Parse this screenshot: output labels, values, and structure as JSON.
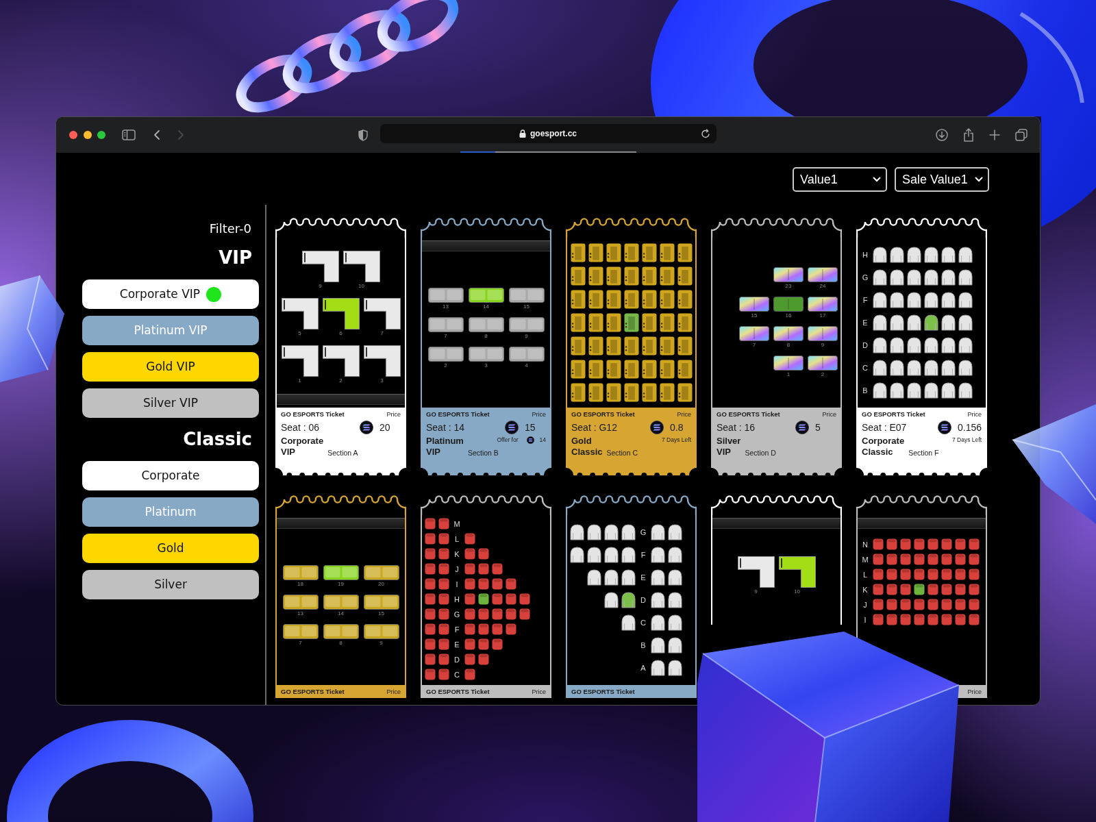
{
  "browser": {
    "url": "goesport.cc",
    "nav": [
      {
        "kind": "back",
        "disabled": false
      },
      {
        "kind": "forward",
        "disabled": true
      }
    ],
    "load_progress": {
      "level": 0.2
    }
  },
  "filters": {
    "selects": [
      {
        "value": "Value1"
      },
      {
        "value": "Sale Value1"
      }
    ]
  },
  "sidebar": {
    "title": "Filter-0",
    "groups": [
      {
        "heading": "VIP",
        "items": [
          {
            "label": "Corporate VIP",
            "color": "#ffffff",
            "selected": true
          },
          {
            "label": "Platinum VIP",
            "color": "#87a9c5",
            "selected": false
          },
          {
            "label": "Gold VIP",
            "color": "#ffd700",
            "selected": false
          },
          {
            "label": "Silver VIP",
            "color": "#c0c0c0",
            "selected": false
          }
        ]
      },
      {
        "heading": "Classic",
        "items": [
          {
            "label": "Corporate",
            "color": "#ffffff",
            "selected": false
          },
          {
            "label": "Platinum",
            "color": "#87a9c5",
            "selected": false
          },
          {
            "label": "Gold",
            "color": "#ffd700",
            "selected": false
          },
          {
            "label": "Silver",
            "color": "#c0c0c0",
            "selected": false
          }
        ]
      }
    ]
  },
  "tickets": [
    {
      "color": "#ffffff",
      "header": "GO ESPORTS Ticket",
      "price_label": "Price",
      "seat": "Seat : 06",
      "price": "20",
      "tier": "Corporate VIP",
      "section": "Section A",
      "map": {
        "kind": "desk",
        "stage_bottom": true,
        "rows": [
          {
            "seats": [
              {
                "number": "9",
                "selected": false
              },
              {
                "number": "10",
                "selected": false
              }
            ]
          },
          {
            "seats": [
              {
                "number": "5",
                "selected": false
              },
              {
                "number": "6",
                "selected": true
              },
              {
                "number": "7",
                "selected": false
              }
            ]
          },
          {
            "seats": [
              {
                "number": "1",
                "selected": false
              },
              {
                "number": "2",
                "selected": false
              },
              {
                "number": "3",
                "selected": false
              }
            ]
          }
        ]
      }
    },
    {
      "color": "#87a9c5",
      "header": "GO ESPORTS Ticket",
      "price_label": "Price",
      "seat": "Seat : 14",
      "price": "15",
      "tier": "Platinum VIP",
      "offer": {
        "label": "Offer for",
        "price": "14"
      },
      "section": "Section B",
      "map": {
        "kind": "sofa",
        "stage_top": true,
        "rows": [
          {
            "seats": [
              {
                "number": "13",
                "selected": false
              },
              {
                "number": "14",
                "selected": true
              },
              {
                "number": "15",
                "selected": false
              }
            ]
          },
          {
            "seats": [
              {
                "number": "7",
                "selected": false
              },
              {
                "number": "8",
                "selected": false
              },
              {
                "number": "9",
                "selected": false
              }
            ]
          },
          {
            "seats": [
              {
                "number": "2",
                "selected": false
              },
              {
                "number": "3",
                "selected": false
              },
              {
                "number": "4",
                "selected": false
              }
            ]
          }
        ]
      }
    },
    {
      "color": "#d6a532",
      "header": "GO ESPORTS Ticket",
      "price_label": "Price",
      "seat": "Seat : G12",
      "price": "0.8",
      "tier": "Gold Classic",
      "time_left": "7 Days Left",
      "section": "Section C",
      "map": {
        "kind": "chair",
        "rows": [
          {
            "seats": [
              {
                "selected": false
              },
              {
                "selected": false
              },
              {
                "selected": false
              },
              {
                "selected": false
              },
              {
                "selected": false
              },
              {
                "selected": false
              },
              {
                "selected": false
              }
            ]
          },
          {
            "seats": [
              {
                "selected": false
              },
              {
                "selected": false
              },
              {
                "selected": false
              },
              {
                "selected": false
              },
              {
                "selected": false
              },
              {
                "selected": false
              },
              {
                "selected": false
              }
            ]
          },
          {
            "seats": [
              {
                "selected": false
              },
              {
                "selected": false
              },
              {
                "selected": false
              },
              {
                "selected": false
              },
              {
                "selected": false
              },
              {
                "selected": false
              },
              {
                "selected": false
              }
            ]
          },
          {
            "seats": [
              {
                "selected": false
              },
              {
                "selected": false
              },
              {
                "selected": false
              },
              {
                "selected": true
              },
              {
                "selected": false
              },
              {
                "selected": false
              },
              {
                "selected": false
              }
            ]
          },
          {
            "seats": [
              {
                "selected": false
              },
              {
                "selected": false
              },
              {
                "selected": false
              },
              {
                "selected": false
              },
              {
                "selected": false
              },
              {
                "selected": false
              },
              {
                "selected": false
              }
            ]
          },
          {
            "seats": [
              {
                "selected": false
              },
              {
                "selected": false
              },
              {
                "selected": false
              },
              {
                "selected": false
              },
              {
                "selected": false
              },
              {
                "selected": false
              },
              {
                "selected": false
              }
            ]
          },
          {
            "seats": [
              {
                "selected": false
              },
              {
                "selected": false
              },
              {
                "selected": false
              },
              {
                "selected": false
              },
              {
                "selected": false
              },
              {
                "selected": false
              },
              {
                "selected": false
              }
            ]
          }
        ]
      }
    },
    {
      "color": "#bdbdbd",
      "header": "GO ESPORTS Ticket",
      "price_label": "Price",
      "seat": "Seat : 16",
      "price": "5",
      "tier": "Silver VIP",
      "section": "Section D",
      "map": {
        "kind": "pod",
        "rows": [
          {
            "seats": [
              {
                "number": "23",
                "selected": false
              },
              {
                "number": "24",
                "selected": false
              }
            ]
          },
          {
            "seats": [
              {
                "number": "15",
                "selected": false
              },
              {
                "number": "16",
                "selected": true
              },
              {
                "number": "17",
                "selected": false
              }
            ]
          },
          {
            "seats": [
              {
                "number": "7",
                "selected": false
              },
              {
                "number": "8",
                "selected": false
              },
              {
                "number": "9",
                "selected": false
              }
            ]
          },
          {
            "seats": [
              {
                "number": "1",
                "selected": false
              },
              {
                "number": "2",
                "selected": false
              }
            ]
          }
        ]
      }
    },
    {
      "color": "#ffffff",
      "header": "GO ESPORTS Ticket",
      "price_label": "Price",
      "seat": "Seat : E07",
      "price": "0.156",
      "tier": "Corporate Classic",
      "time_left": "7 Days Left",
      "section": "Section F",
      "map": {
        "kind": "armchair",
        "rows": [
          {
            "label": "H",
            "seats": [
              {
                "selected": false
              },
              {
                "selected": false
              },
              {
                "selected": false
              },
              {
                "selected": false
              },
              {
                "selected": false
              },
              {
                "selected": false
              }
            ]
          },
          {
            "label": "G",
            "seats": [
              {
                "selected": false
              },
              {
                "selected": false
              },
              {
                "selected": false
              },
              {
                "selected": false
              },
              {
                "selected": false
              },
              {
                "selected": false
              }
            ]
          },
          {
            "label": "F",
            "seats": [
              {
                "selected": false
              },
              {
                "selected": false
              },
              {
                "selected": false
              },
              {
                "selected": false
              },
              {
                "selected": false
              },
              {
                "selected": false
              }
            ]
          },
          {
            "label": "E",
            "seats": [
              {
                "selected": false
              },
              {
                "selected": false
              },
              {
                "selected": false
              },
              {
                "selected": true
              },
              {
                "selected": false
              },
              {
                "selected": false
              }
            ]
          },
          {
            "label": "D",
            "seats": [
              {
                "selected": false
              },
              {
                "selected": false
              },
              {
                "selected": false
              },
              {
                "selected": false
              },
              {
                "selected": false
              },
              {
                "selected": false
              }
            ]
          },
          {
            "label": "C",
            "seats": [
              {
                "selected": false
              },
              {
                "selected": false
              },
              {
                "selected": false
              },
              {
                "selected": false
              },
              {
                "selected": false
              },
              {
                "selected": false
              }
            ]
          },
          {
            "label": "B",
            "seats": [
              {
                "selected": false
              },
              {
                "selected": false
              },
              {
                "selected": false
              },
              {
                "selected": false
              },
              {
                "selected": false
              },
              {
                "selected": false
              }
            ]
          }
        ]
      }
    },
    {
      "color": "#d6a532",
      "header": "GO ESPORTS Ticket",
      "price_label": "Price",
      "map": {
        "kind": "bench",
        "stage_top": true,
        "rows": [
          {
            "seats": [
              {
                "number": "18",
                "selected": false
              },
              {
                "number": "19",
                "selected": true
              },
              {
                "number": "20",
                "selected": false
              }
            ]
          },
          {
            "seats": [
              {
                "number": "13",
                "selected": false
              },
              {
                "number": "14",
                "selected": false
              },
              {
                "number": "15",
                "selected": false
              }
            ]
          },
          {
            "seats": [
              {
                "number": "7",
                "selected": false
              },
              {
                "number": "8",
                "selected": false
              },
              {
                "number": "9",
                "selected": false
              }
            ]
          }
        ]
      }
    },
    {
      "color": "#bdbdbd",
      "header": "GO ESPORTS Ticket",
      "price_label": "Price",
      "map": {
        "kind": "cinema",
        "rows": [
          {
            "before": [
              {
                "selected": false
              },
              {
                "selected": false
              }
            ],
            "label": "M"
          },
          {
            "before": [
              {
                "selected": false
              },
              {
                "selected": false
              }
            ],
            "label": "L",
            "seats": [
              {
                "selected": false
              }
            ]
          },
          {
            "before": [
              {
                "selected": false
              },
              {
                "selected": false
              }
            ],
            "label": "K",
            "seats": [
              {
                "selected": false
              },
              {
                "selected": false
              }
            ]
          },
          {
            "before": [
              {
                "selected": false
              },
              {
                "selected": false
              }
            ],
            "label": "J",
            "seats": [
              {
                "selected": false
              },
              {
                "selected": false
              },
              {
                "selected": false
              }
            ]
          },
          {
            "before": [
              {
                "selected": false
              },
              {
                "selected": false
              }
            ],
            "label": "I",
            "seats": [
              {
                "selected": false
              },
              {
                "selected": false
              },
              {
                "selected": false
              },
              {
                "selected": false
              }
            ]
          },
          {
            "before": [
              {
                "selected": false
              },
              {
                "selected": false
              }
            ],
            "label": "H",
            "seats": [
              {
                "selected": false
              },
              {
                "selected": true
              },
              {
                "selected": false
              },
              {
                "selected": false
              },
              {
                "selected": false
              }
            ]
          },
          {
            "before": [
              {
                "selected": false
              },
              {
                "selected": false
              }
            ],
            "label": "G",
            "seats": [
              {
                "selected": false
              },
              {
                "selected": false
              },
              {
                "selected": false
              },
              {
                "selected": false
              },
              {
                "selected": false
              }
            ]
          },
          {
            "before": [
              {
                "selected": false
              },
              {
                "selected": false
              }
            ],
            "label": "F",
            "seats": [
              {
                "selected": false
              },
              {
                "selected": false
              },
              {
                "selected": false
              },
              {
                "selected": false
              }
            ]
          },
          {
            "before": [
              {
                "selected": false
              },
              {
                "selected": false
              }
            ],
            "label": "E",
            "seats": [
              {
                "selected": false
              },
              {
                "selected": false
              },
              {
                "selected": false
              }
            ]
          },
          {
            "before": [
              {
                "selected": false
              },
              {
                "selected": false
              }
            ],
            "label": "D",
            "seats": [
              {
                "selected": false
              },
              {
                "selected": false
              }
            ]
          },
          {
            "before": [
              {
                "selected": false
              },
              {
                "selected": false
              }
            ],
            "label": "C",
            "seats": [
              {
                "selected": false
              }
            ]
          }
        ]
      }
    },
    {
      "color": "#87a9c5",
      "header": "GO ESPORTS Ticket",
      "map": {
        "kind": "armchair",
        "rows": [
          {
            "before": [
              {
                "selected": false
              },
              {
                "selected": false
              },
              {
                "selected": false
              },
              {
                "selected": false
              }
            ],
            "label": "G",
            "seats": [
              {
                "selected": false
              },
              {
                "selected": false
              }
            ]
          },
          {
            "before": [
              {
                "selected": false
              },
              {
                "selected": false
              },
              {
                "selected": false
              },
              {
                "selected": false
              }
            ],
            "label": "F",
            "seats": [
              {
                "selected": false
              },
              {
                "selected": false
              }
            ]
          },
          {
            "before": [
              {
                "selected": false
              },
              {
                "selected": false
              },
              {
                "selected": false
              }
            ],
            "label": "E",
            "seats": [
              {
                "selected": false
              },
              {
                "selected": false
              }
            ]
          },
          {
            "before": [
              {
                "selected": false
              },
              {
                "selected": true
              }
            ],
            "label": "D",
            "seats": [
              {
                "selected": false
              },
              {
                "selected": false
              }
            ]
          },
          {
            "before": [
              {
                "selected": false
              }
            ],
            "label": "C",
            "seats": [
              {
                "selected": false
              },
              {
                "selected": false
              }
            ]
          },
          {
            "label": "B",
            "seats": [
              {
                "selected": false
              },
              {
                "selected": false
              }
            ]
          },
          {
            "label": "A",
            "seats": [
              {
                "selected": false
              },
              {
                "selected": false
              }
            ]
          }
        ]
      }
    },
    {
      "color": "#ffffff",
      "map": {
        "kind": "desk",
        "stage_top": true,
        "rows": [
          {
            "seats": [
              {
                "number": "9",
                "selected": false
              },
              {
                "number": "10",
                "selected": true
              }
            ]
          }
        ]
      }
    },
    {
      "color": "#bdbdbd",
      "price_label": "Price",
      "map": {
        "kind": "cinema",
        "stage_top": true,
        "rows": [
          {
            "label": "N",
            "seats": [
              {
                "selected": false
              },
              {
                "selected": false
              },
              {
                "selected": false
              },
              {
                "selected": false
              },
              {
                "selected": false
              },
              {
                "selected": false
              },
              {
                "selected": false
              },
              {
                "selected": false
              }
            ]
          },
          {
            "label": "M",
            "seats": [
              {
                "selected": false
              },
              {
                "selected": false
              },
              {
                "selected": false
              },
              {
                "selected": false
              },
              {
                "selected": false
              },
              {
                "selected": false
              },
              {
                "selected": false
              },
              {
                "selected": false
              }
            ]
          },
          {
            "label": "L",
            "seats": [
              {
                "selected": false
              },
              {
                "selected": false
              },
              {
                "selected": false
              },
              {
                "selected": false
              },
              {
                "selected": false
              },
              {
                "selected": false
              },
              {
                "selected": false
              },
              {
                "selected": false
              }
            ]
          },
          {
            "label": "K",
            "seats": [
              {
                "selected": false
              },
              {
                "selected": false
              },
              {
                "selected": false
              },
              {
                "selected": true
              },
              {
                "selected": false
              },
              {
                "selected": false
              },
              {
                "selected": false
              },
              {
                "selected": false
              }
            ]
          },
          {
            "label": "J",
            "seats": [
              {
                "selected": false
              },
              {
                "selected": false
              },
              {
                "selected": false
              },
              {
                "selected": false
              },
              {
                "selected": false
              },
              {
                "selected": false
              },
              {
                "selected": false
              },
              {
                "selected": false
              }
            ]
          },
          {
            "label": "I",
            "seats": [
              {
                "selected": false
              },
              {
                "selected": false
              },
              {
                "selected": false
              },
              {
                "selected": false
              },
              {
                "selected": false
              },
              {
                "selected": false
              },
              {
                "selected": false
              },
              {
                "selected": false
              }
            ]
          }
        ]
      }
    }
  ]
}
